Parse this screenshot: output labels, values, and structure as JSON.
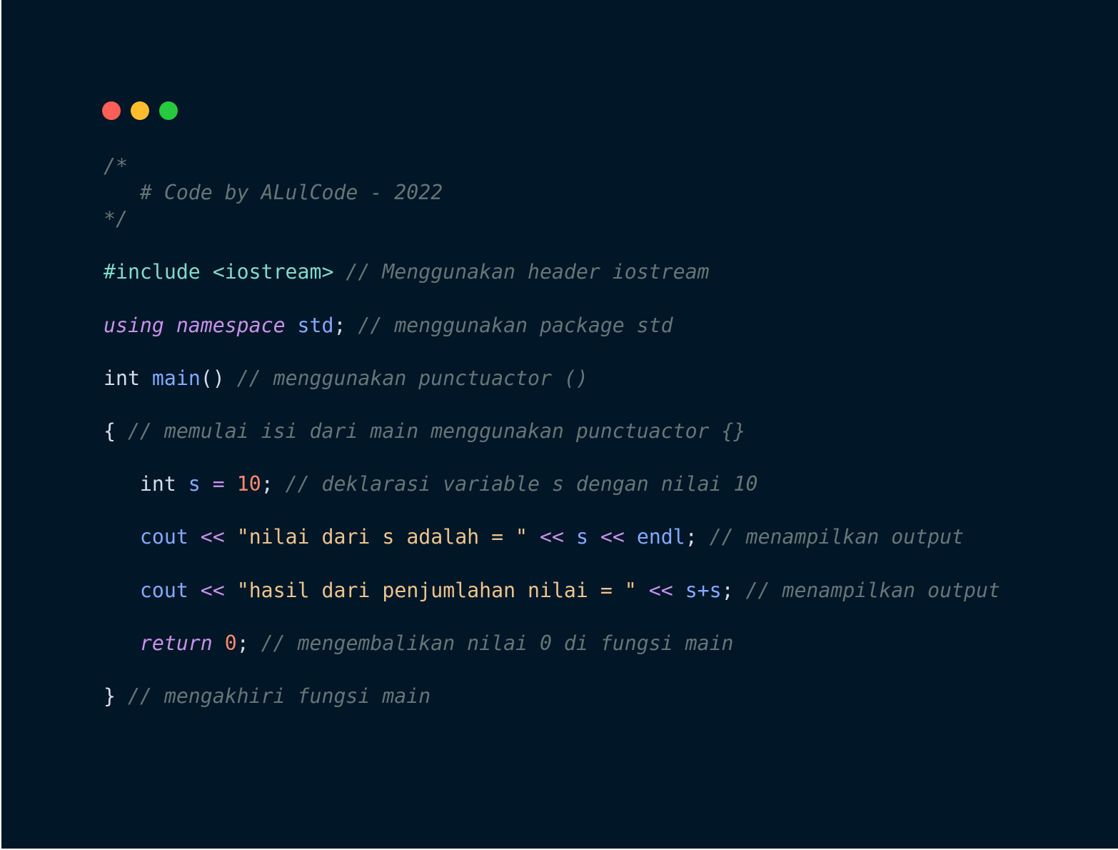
{
  "window": {
    "background": "#011627",
    "traffic_lights": [
      {
        "name": "close",
        "color": "#ff5f56"
      },
      {
        "name": "minimize",
        "color": "#ffbd2e"
      },
      {
        "name": "maximize",
        "color": "#27c93f"
      }
    ]
  },
  "colors": {
    "comment": "#637777",
    "preprocessor": "#7fdbca",
    "keyword": "#c792ea",
    "type": "#d6deeb",
    "identifier": "#82aaff",
    "plain": "#d6deeb",
    "number": "#f78c6c",
    "string": "#ecc48d"
  },
  "code_lines": [
    [
      {
        "t": "/*",
        "c": "comment"
      }
    ],
    [
      {
        "t": "   # Code by ALulCode - 2022",
        "c": "comment"
      }
    ],
    [
      {
        "t": "*/",
        "c": "comment"
      }
    ],
    [],
    [
      {
        "t": "#include <iostream>",
        "c": "preprocessor"
      },
      {
        "t": " ",
        "c": "plain"
      },
      {
        "t": "// Menggunakan header iostream",
        "c": "comment"
      }
    ],
    [],
    [
      {
        "t": "using namespace",
        "c": "keyword",
        "i": true
      },
      {
        "t": " ",
        "c": "plain"
      },
      {
        "t": "std",
        "c": "identifier"
      },
      {
        "t": "; ",
        "c": "plain"
      },
      {
        "t": "// menggunakan package std",
        "c": "comment"
      }
    ],
    [],
    [
      {
        "t": "int",
        "c": "type"
      },
      {
        "t": " ",
        "c": "plain"
      },
      {
        "t": "main",
        "c": "identifier"
      },
      {
        "t": "() ",
        "c": "plain"
      },
      {
        "t": "// menggunakan punctuactor ()",
        "c": "comment"
      }
    ],
    [],
    [
      {
        "t": "{ ",
        "c": "plain"
      },
      {
        "t": "// memulai isi dari main menggunakan punctuactor {}",
        "c": "comment"
      }
    ],
    [],
    [
      {
        "t": "   int ",
        "c": "type"
      },
      {
        "t": "s",
        "c": "identifier"
      },
      {
        "t": " ",
        "c": "plain"
      },
      {
        "t": "=",
        "c": "keyword"
      },
      {
        "t": " ",
        "c": "plain"
      },
      {
        "t": "10",
        "c": "number"
      },
      {
        "t": "; ",
        "c": "plain"
      },
      {
        "t": "// deklarasi variable s dengan nilai 10",
        "c": "comment"
      }
    ],
    [],
    [
      {
        "t": "   ",
        "c": "plain"
      },
      {
        "t": "cout",
        "c": "identifier"
      },
      {
        "t": " ",
        "c": "plain"
      },
      {
        "t": "<<",
        "c": "keyword"
      },
      {
        "t": " ",
        "c": "plain"
      },
      {
        "t": "\"nilai dari s adalah = \"",
        "c": "string"
      },
      {
        "t": " ",
        "c": "plain"
      },
      {
        "t": "<<",
        "c": "keyword"
      },
      {
        "t": " ",
        "c": "plain"
      },
      {
        "t": "s",
        "c": "identifier"
      },
      {
        "t": " ",
        "c": "plain"
      },
      {
        "t": "<<",
        "c": "keyword"
      },
      {
        "t": " ",
        "c": "plain"
      },
      {
        "t": "endl",
        "c": "identifier"
      },
      {
        "t": "; ",
        "c": "plain"
      },
      {
        "t": "// menampilkan output",
        "c": "comment"
      }
    ],
    [],
    [
      {
        "t": "   ",
        "c": "plain"
      },
      {
        "t": "cout",
        "c": "identifier"
      },
      {
        "t": " ",
        "c": "plain"
      },
      {
        "t": "<<",
        "c": "keyword"
      },
      {
        "t": " ",
        "c": "plain"
      },
      {
        "t": "\"hasil dari penjumlahan nilai = \"",
        "c": "string"
      },
      {
        "t": " ",
        "c": "plain"
      },
      {
        "t": "<<",
        "c": "keyword"
      },
      {
        "t": " ",
        "c": "plain"
      },
      {
        "t": "s+s",
        "c": "identifier"
      },
      {
        "t": "; ",
        "c": "plain"
      },
      {
        "t": "// menampilkan output",
        "c": "comment"
      }
    ],
    [],
    [
      {
        "t": "   ",
        "c": "plain"
      },
      {
        "t": "return",
        "c": "keyword",
        "i": true
      },
      {
        "t": " ",
        "c": "plain"
      },
      {
        "t": "0",
        "c": "number"
      },
      {
        "t": "; ",
        "c": "plain"
      },
      {
        "t": "// mengembalikan nilai 0 di fungsi main",
        "c": "comment"
      }
    ],
    [],
    [
      {
        "t": "} ",
        "c": "plain"
      },
      {
        "t": "// mengakhiri fungsi main",
        "c": "comment"
      }
    ]
  ]
}
